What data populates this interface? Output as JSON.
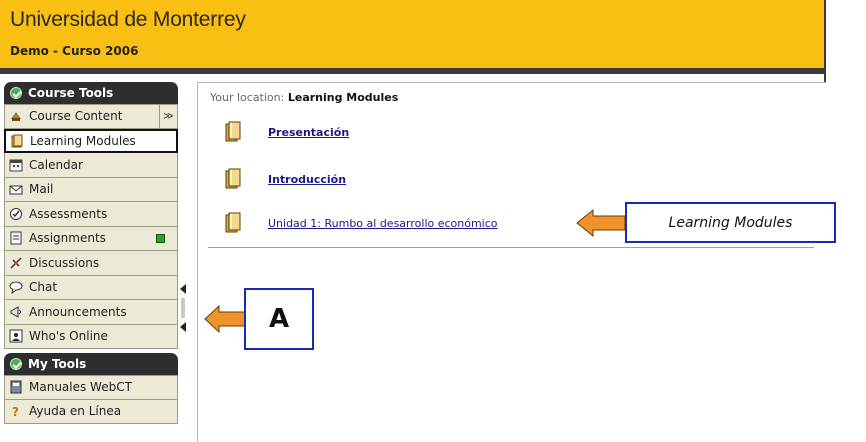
{
  "header": {
    "institution": "Universidad de Monterrey",
    "course": "Demo - Curso 2006"
  },
  "sidebar": {
    "course_tools_title": "Course Tools",
    "course_tools": [
      {
        "label": "Course Content",
        "icon": "course-content-icon",
        "expand": "≫"
      },
      {
        "label": "Learning Modules",
        "icon": "book-icon",
        "selected": true
      },
      {
        "label": "Calendar",
        "icon": "calendar-icon"
      },
      {
        "label": "Mail",
        "icon": "mail-icon"
      },
      {
        "label": "Assessments",
        "icon": "assessments-icon"
      },
      {
        "label": "Assignments",
        "icon": "assignments-icon",
        "badge": "new"
      },
      {
        "label": "Discussions",
        "icon": "discussions-icon"
      },
      {
        "label": "Chat",
        "icon": "chat-icon"
      },
      {
        "label": "Announcements",
        "icon": "announcements-icon"
      },
      {
        "label": "Who's Online",
        "icon": "whos-online-icon"
      }
    ],
    "my_tools_title": "My Tools",
    "my_tools": [
      {
        "label": "Manuales WebCT",
        "icon": "manual-icon"
      },
      {
        "label": "Ayuda en Línea",
        "icon": "help-icon"
      }
    ]
  },
  "main": {
    "breadcrumb_prefix": "Your location:",
    "breadcrumb_location": "Learning Modules",
    "modules": [
      {
        "label": "Presentación",
        "bold": true
      },
      {
        "label": "Introducción",
        "bold": true
      },
      {
        "label": "Unidad 1: Rumbo al desarrollo económico",
        "bold": false
      }
    ]
  },
  "callouts": {
    "learning_modules": "Learning Modules",
    "a": "A"
  },
  "colors": {
    "header_bg": "#f9bf13",
    "nav_bg": "#ecead6",
    "nav_header_bg": "#2e2e2e",
    "link": "#1a1a8c",
    "callout_border": "#1a2ab8",
    "arrow": "#f0922a"
  }
}
